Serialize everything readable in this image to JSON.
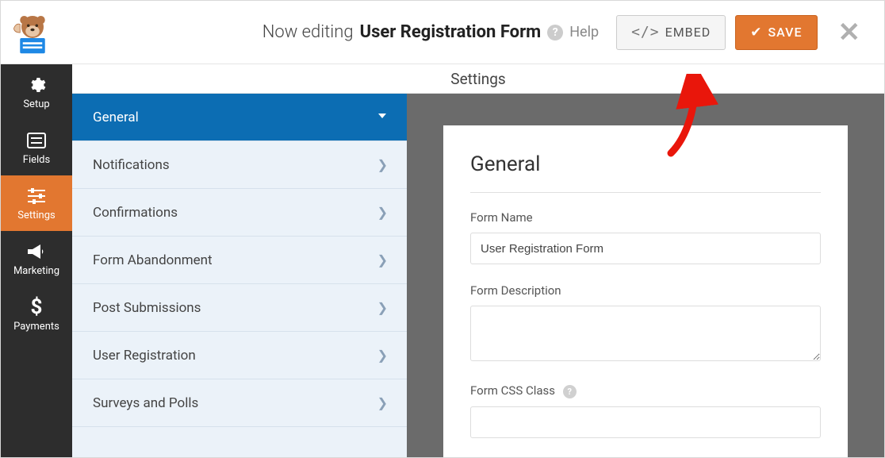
{
  "header": {
    "now_editing": "Now editing",
    "form_name": "User Registration Form",
    "help_label": "Help",
    "embed_label": "EMBED",
    "save_label": "SAVE"
  },
  "vnav": {
    "setup": "Setup",
    "fields": "Fields",
    "settings": "Settings",
    "marketing": "Marketing",
    "payments": "Payments",
    "active": "settings"
  },
  "page_title": "Settings",
  "settings_list": {
    "items": [
      {
        "label": "General",
        "active": true
      },
      {
        "label": "Notifications",
        "active": false
      },
      {
        "label": "Confirmations",
        "active": false
      },
      {
        "label": "Form Abandonment",
        "active": false
      },
      {
        "label": "Post Submissions",
        "active": false
      },
      {
        "label": "User Registration",
        "active": false
      },
      {
        "label": "Surveys and Polls",
        "active": false
      }
    ]
  },
  "form_panel": {
    "heading": "General",
    "form_name_label": "Form Name",
    "form_name_value": "User Registration Form",
    "form_description_label": "Form Description",
    "form_description_value": "",
    "form_css_class_label": "Form CSS Class",
    "form_css_class_value": ""
  }
}
